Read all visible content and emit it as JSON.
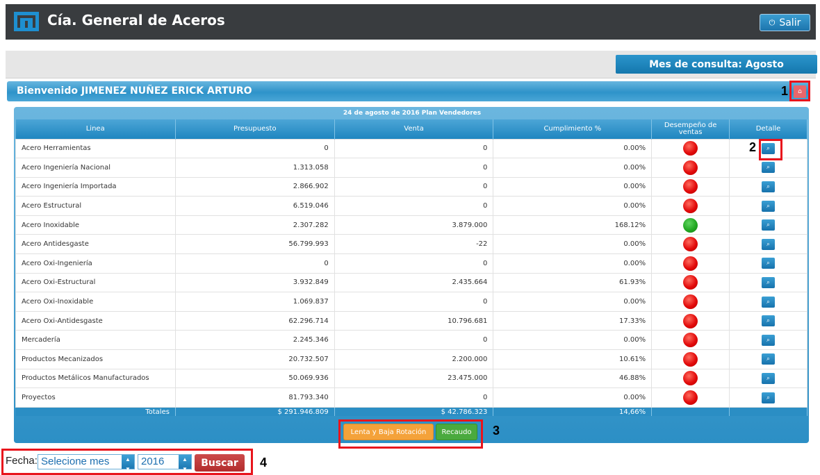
{
  "header": {
    "title": "Cía. General de Aceros",
    "exit_label": "Salir",
    "exit_icon": "power-icon"
  },
  "month_query": "Mes de consulta: Agosto",
  "welcome": "Bienvenido JIMENEZ NUÑEZ ERICK ARTURO",
  "annotations": [
    "1",
    "2",
    "3",
    "4"
  ],
  "table": {
    "title": "24 de agosto de 2016 Plan Vendedores",
    "columns": [
      "Linea",
      "Presupuesto",
      "Venta",
      "Cumplimiento %",
      "Desempeño de ventas",
      "Detalle"
    ],
    "rows": [
      {
        "linea": "Acero Herramientas",
        "presupuesto": "0",
        "venta": "0",
        "cumplimiento": "0.00%",
        "status": "red"
      },
      {
        "linea": "Acero Ingeniería Nacional",
        "presupuesto": "1.313.058",
        "venta": "0",
        "cumplimiento": "0.00%",
        "status": "red"
      },
      {
        "linea": "Acero Ingeniería Importada",
        "presupuesto": "2.866.902",
        "venta": "0",
        "cumplimiento": "0.00%",
        "status": "red"
      },
      {
        "linea": "Acero Estructural",
        "presupuesto": "6.519.046",
        "venta": "0",
        "cumplimiento": "0.00%",
        "status": "red"
      },
      {
        "linea": "Acero Inoxidable",
        "presupuesto": "2.307.282",
        "venta": "3.879.000",
        "cumplimiento": "168.12%",
        "status": "green"
      },
      {
        "linea": "Acero Antidesgaste",
        "presupuesto": "56.799.993",
        "venta": "-22",
        "cumplimiento": "0.00%",
        "status": "red"
      },
      {
        "linea": "Acero Oxi-Ingeniería",
        "presupuesto": "0",
        "venta": "0",
        "cumplimiento": "0.00%",
        "status": "red"
      },
      {
        "linea": "Acero Oxi-Estructural",
        "presupuesto": "3.932.849",
        "venta": "2.435.664",
        "cumplimiento": "61.93%",
        "status": "red"
      },
      {
        "linea": "Acero Oxi-Inoxidable",
        "presupuesto": "1.069.837",
        "venta": "0",
        "cumplimiento": "0.00%",
        "status": "red"
      },
      {
        "linea": "Acero Oxi-Antidesgaste",
        "presupuesto": "62.296.714",
        "venta": "10.796.681",
        "cumplimiento": "17.33%",
        "status": "red"
      },
      {
        "linea": "Mercadería",
        "presupuesto": "2.245.346",
        "venta": "0",
        "cumplimiento": "0.00%",
        "status": "red"
      },
      {
        "linea": "Productos Mecanizados",
        "presupuesto": "20.732.507",
        "venta": "2.200.000",
        "cumplimiento": "10.61%",
        "status": "red"
      },
      {
        "linea": "Productos Metálicos Manufacturados",
        "presupuesto": "50.069.936",
        "venta": "23.475.000",
        "cumplimiento": "46.88%",
        "status": "red"
      },
      {
        "linea": "Proyectos",
        "presupuesto": "81.793.340",
        "venta": "0",
        "cumplimiento": "0.00%",
        "status": "red"
      }
    ],
    "totals": {
      "label": "Totales",
      "presupuesto": "$ 291.946.809",
      "venta": "$ 42.786.323",
      "cumplimiento": "14,66%"
    }
  },
  "buttons": {
    "slow": "Lenta y Baja Rotación",
    "recaudo": "Recaudo"
  },
  "filter": {
    "label": "Fecha:",
    "month": "Selecione mes",
    "year": "2016",
    "search": "Buscar"
  },
  "colors": {
    "status_red": "#e20b0b",
    "status_green": "#23a823",
    "accent": "#2b8ec4"
  }
}
